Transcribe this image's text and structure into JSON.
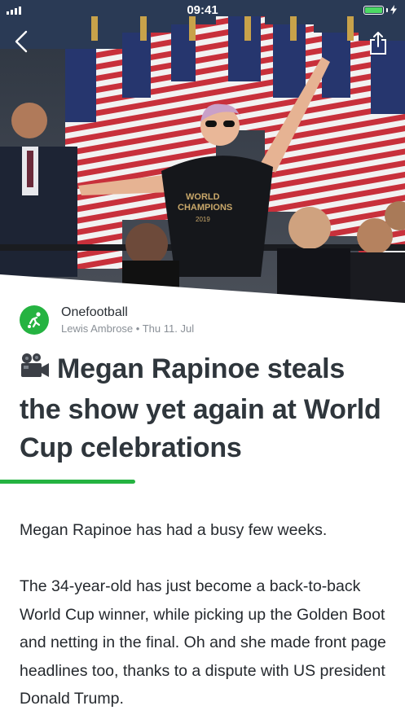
{
  "status_bar": {
    "time": "09:41",
    "battery_color": "#4cd964"
  },
  "header": {
    "back_icon": "chevron-left-icon",
    "share_icon": "share-icon"
  },
  "article": {
    "source": {
      "name": "Onefootball",
      "author": "Lewis Ambrose",
      "separator": "•",
      "date": "Thu 11. Jul",
      "logo_icon": "onefootball-logo-icon"
    },
    "title": "Megan Rapinoe steals the show yet again at World Cup celebrations",
    "title_icon": "movie-camera-icon",
    "paragraphs": [
      "Megan Rapinoe has had a busy few weeks.",
      "The 34-year-old has just become a back-to-back World Cup winner, while picking up the Golden Boot and netting in the final. Oh and she made front page headlines too, thanks to a dispute with US president Donald Trump."
    ],
    "shirt_text": [
      "WORLD",
      "CHAMPIONS",
      "2019"
    ]
  },
  "colors": {
    "accent": "#25b341",
    "title": "#2f363c",
    "meta": "#8a9097"
  }
}
